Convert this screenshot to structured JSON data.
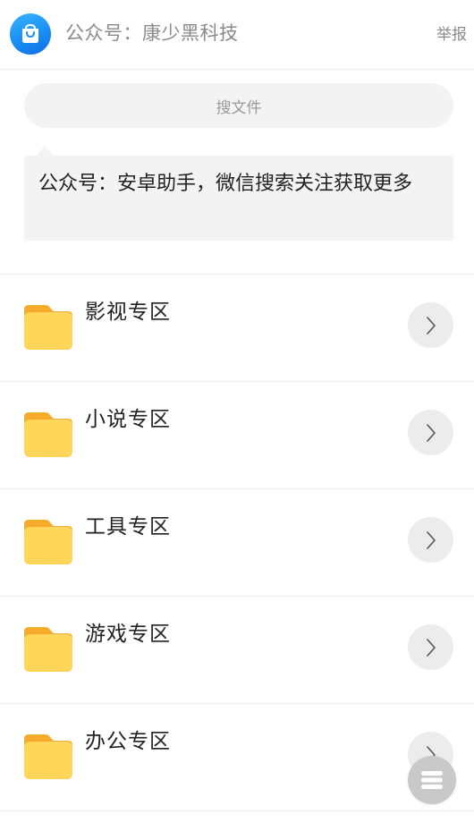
{
  "header": {
    "title": "公众号：康少黑科技",
    "report_label": "举报",
    "avatar_icon": "shopping-bag-icon",
    "accent_color": "#1a8ef5"
  },
  "search": {
    "placeholder": "搜文件"
  },
  "notice": {
    "text": "公众号：安卓助手，微信搜索关注获取更多"
  },
  "folders": [
    {
      "label": "影视专区",
      "icon": "folder-icon",
      "action_icon": "chevron-right-icon"
    },
    {
      "label": "小说专区",
      "icon": "folder-icon",
      "action_icon": "chevron-right-icon"
    },
    {
      "label": "工具专区",
      "icon": "folder-icon",
      "action_icon": "chevron-right-icon"
    },
    {
      "label": "游戏专区",
      "icon": "folder-icon",
      "action_icon": "chevron-right-icon"
    },
    {
      "label": "办公专区",
      "icon": "folder-icon",
      "action_icon": "chevron-right-icon"
    }
  ],
  "fab": {
    "icon": "menu-icon"
  },
  "colors": {
    "folder_front": "#ffd55a",
    "folder_back": "#f6ab2a",
    "button_bg": "#ececec",
    "fab_bg": "#c9c9c9"
  }
}
